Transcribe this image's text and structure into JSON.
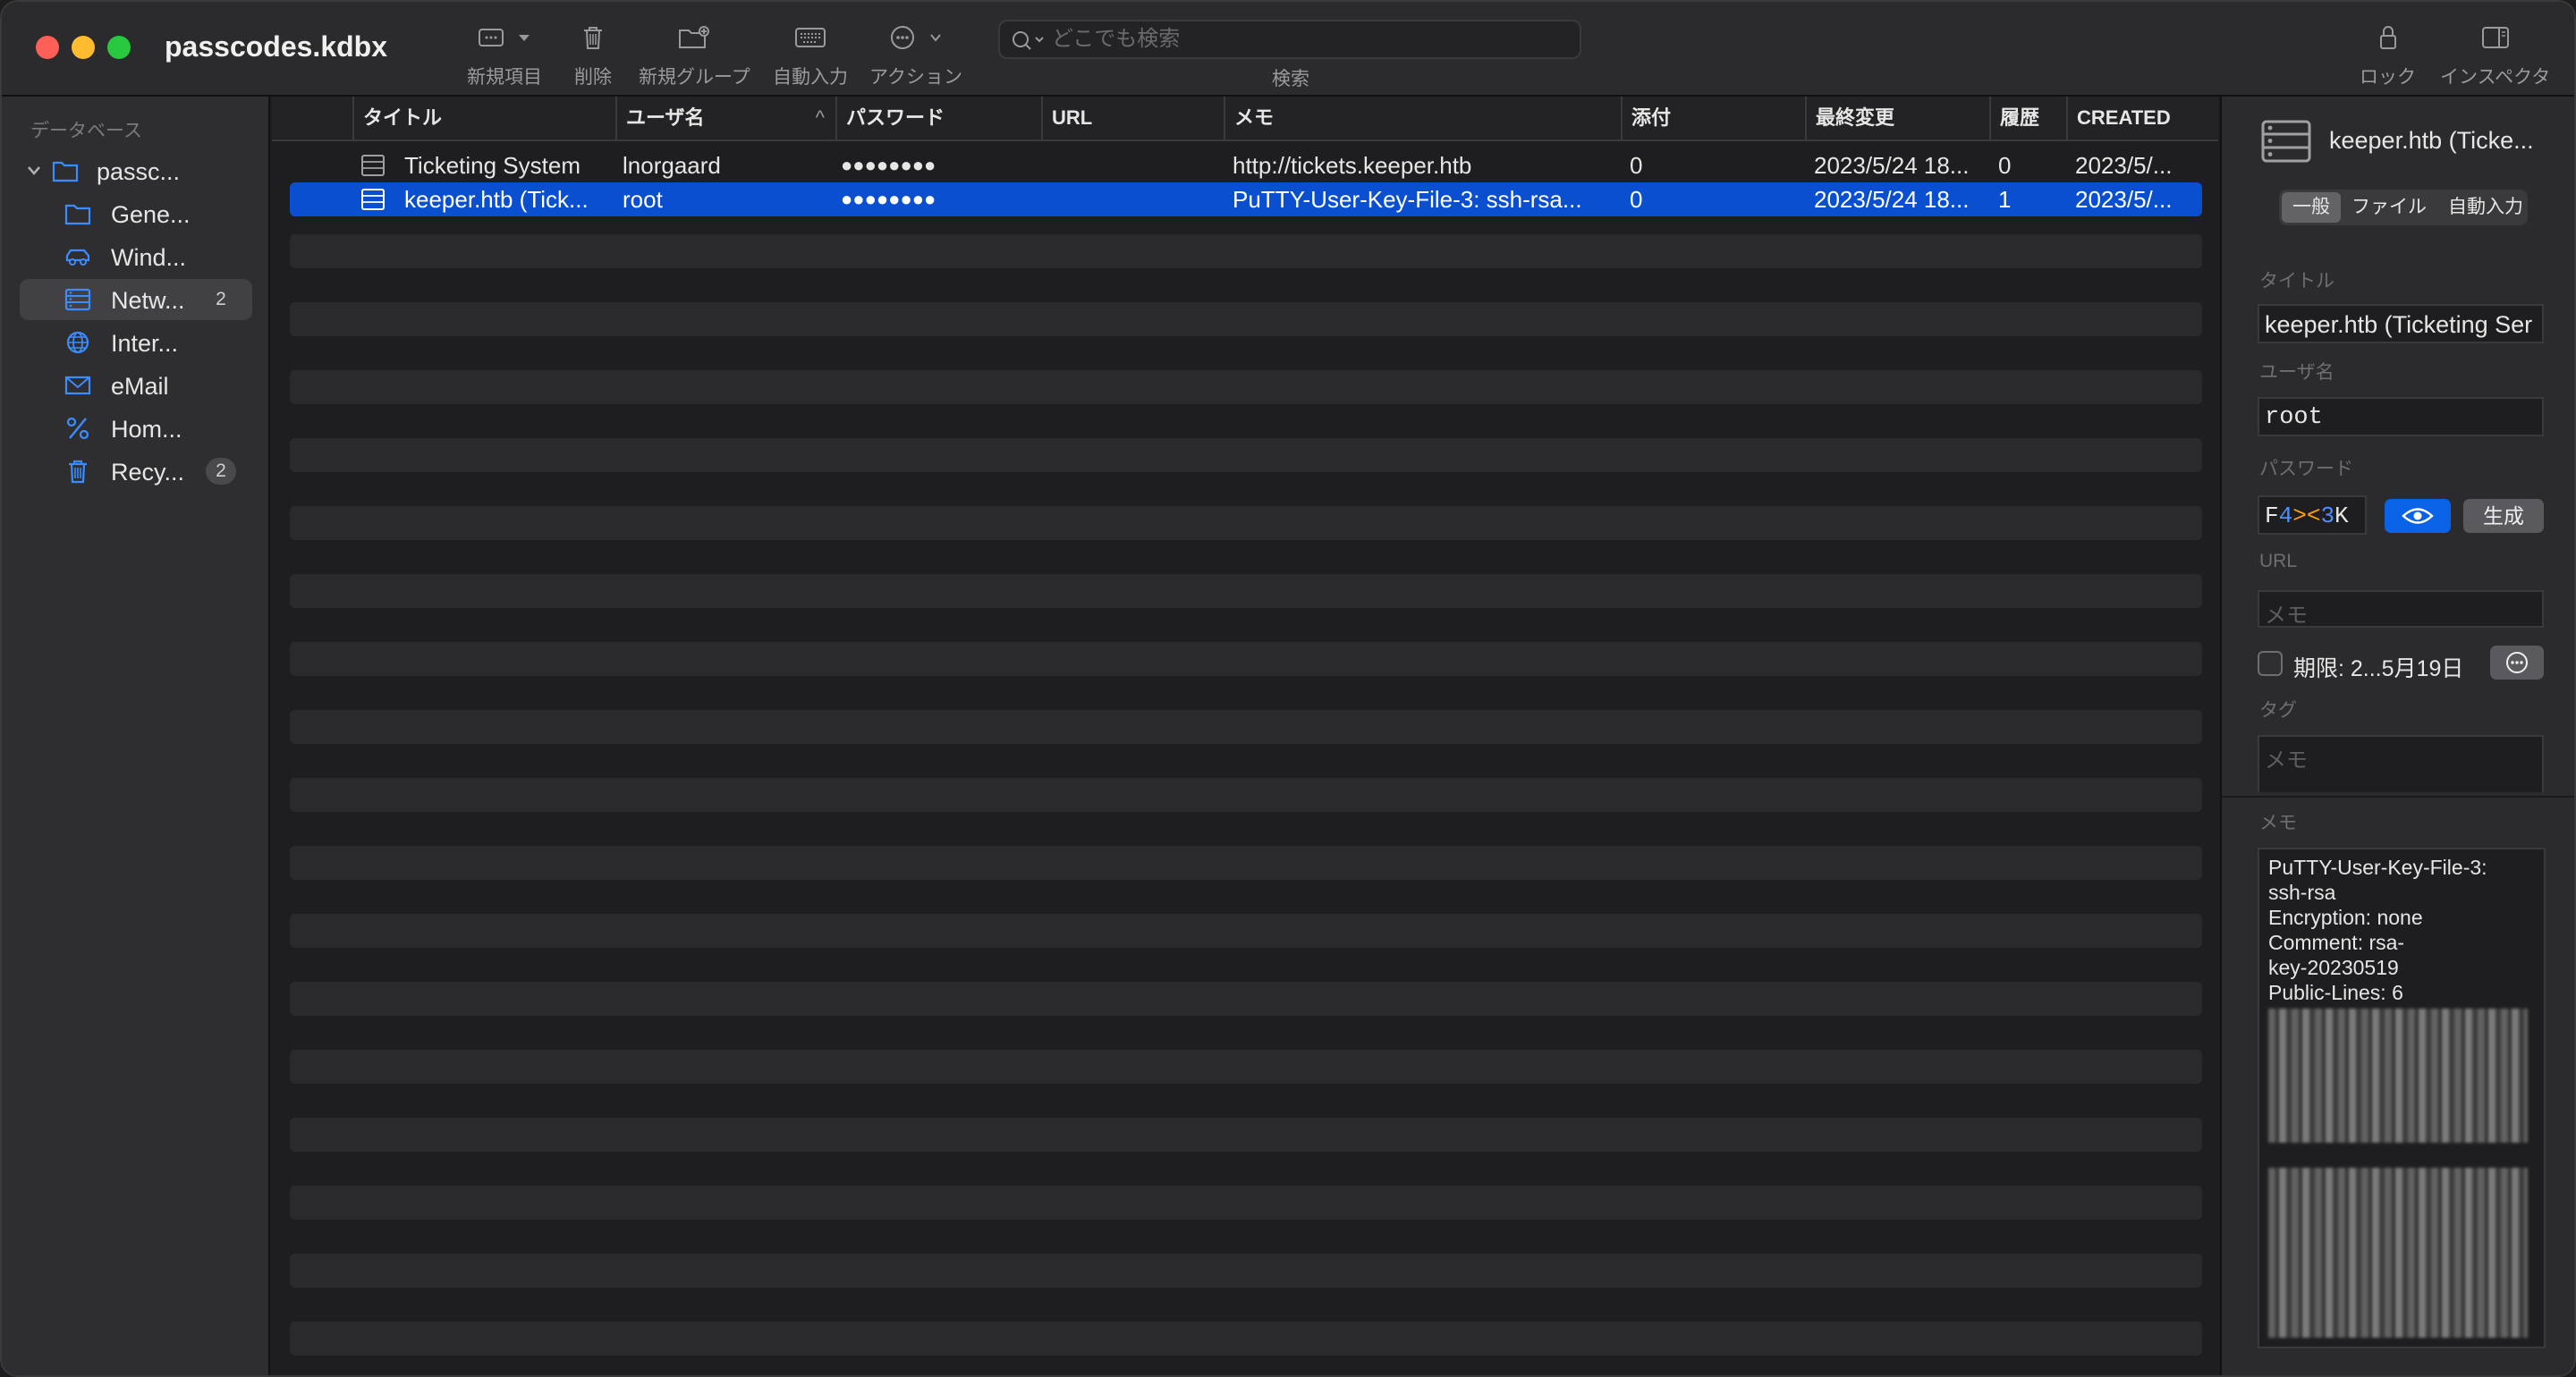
{
  "window": {
    "title": "passcodes.kdbx"
  },
  "toolbar": {
    "new_item": "新規項目",
    "delete": "削除",
    "new_group": "新規グループ",
    "autofill": "自動入力",
    "action": "アクション",
    "search_label": "検索",
    "search_placeholder": "どこでも検索",
    "lock": "ロック",
    "inspector": "インスペクタ"
  },
  "sidebar": {
    "header": "データベース",
    "items": [
      {
        "label": "passc...",
        "icon": "folder-icon",
        "badge": ""
      },
      {
        "label": "Gene...",
        "icon": "folder-icon",
        "badge": ""
      },
      {
        "label": "Wind...",
        "icon": "car-icon",
        "badge": ""
      },
      {
        "label": "Netw...",
        "icon": "server-icon",
        "badge": "2"
      },
      {
        "label": "Inter...",
        "icon": "globe-icon",
        "badge": ""
      },
      {
        "label": "eMail",
        "icon": "envelope-icon",
        "badge": ""
      },
      {
        "label": "Hom...",
        "icon": "percent-icon",
        "badge": ""
      },
      {
        "label": "Recy...",
        "icon": "trash-icon",
        "badge": "2"
      }
    ]
  },
  "table": {
    "columns": [
      "タイトル",
      "ユーザ名",
      "パスワード",
      "URL",
      "メモ",
      "添付",
      "最終変更",
      "履歴",
      "CREATED"
    ],
    "sort_indicator": "^",
    "rows": [
      {
        "title": "Ticketing System",
        "username": "lnorgaard",
        "password": "●●●●●●●●",
        "url": "",
        "notes": "http://tickets.keeper.htb",
        "attachments": "0",
        "modified": "2023/5/24 18...",
        "history": "0",
        "created": "2023/5/..."
      },
      {
        "title": "keeper.htb (Tick...",
        "username": "root",
        "password": "●●●●●●●●",
        "url": "",
        "notes": "PuTTY-User-Key-File-3: ssh-rsa...",
        "attachments": "0",
        "modified": "2023/5/24 18...",
        "history": "1",
        "created": "2023/5/..."
      }
    ]
  },
  "inspector": {
    "entry_title": "keeper.htb (Ticke...",
    "tabs": [
      "一般",
      "ファイル",
      "自動入力"
    ],
    "title_label": "タイトル",
    "title_value": "keeper.htb (Ticketing Ser",
    "username_label": "ユーザ名",
    "username_value": "root",
    "password_label": "パスワード",
    "password_parts": [
      "F",
      "4",
      "><",
      "3",
      "K"
    ],
    "generate": "生成",
    "url_label": "URL",
    "url_placeholder": "メモ",
    "expiry_label": "期限: 2...5月19日",
    "tags_label": "タグ",
    "tags_placeholder": "メモ",
    "notes_label": "メモ",
    "notes_lines": [
      "PuTTY-User-Key-File-3:",
      "ssh-rsa",
      "Encryption: none",
      "Comment: rsa-",
      "key-20230519",
      "Public-Lines: 6"
    ]
  },
  "colors": {
    "selection": "#0b4fd1",
    "accent": "#0a63e6",
    "sidebar_icon": "#3b8cff"
  }
}
